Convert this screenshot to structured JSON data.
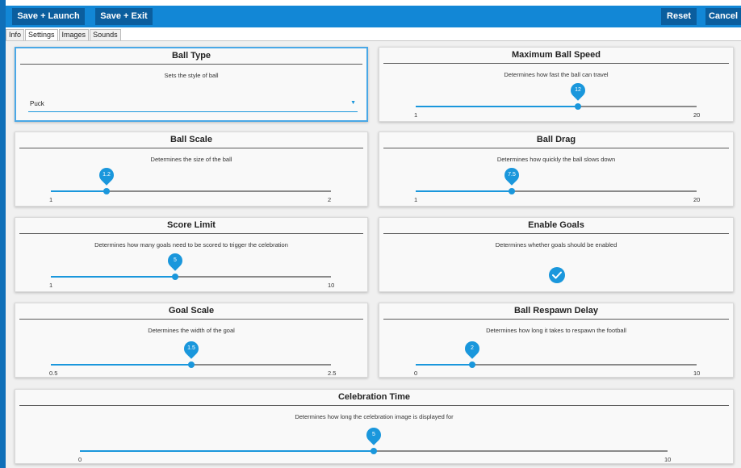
{
  "toolbar": {
    "save_launch": "Save + Launch",
    "save_exit": "Save + Exit",
    "reset": "Reset",
    "cancel": "Cancel"
  },
  "tabs": [
    {
      "label": "Info",
      "active": false
    },
    {
      "label": "Settings",
      "active": true
    },
    {
      "label": "Images",
      "active": false
    },
    {
      "label": "Sounds",
      "active": false
    }
  ],
  "settings": {
    "ball_type": {
      "title": "Ball Type",
      "desc": "Sets the style of ball",
      "value": "Puck"
    },
    "max_ball_speed": {
      "title": "Maximum Ball Speed",
      "desc": "Determines how fast the ball can travel",
      "value": "12",
      "value_num": 12,
      "min": "1",
      "max": "20",
      "min_num": 1,
      "max_num": 20
    },
    "ball_scale": {
      "title": "Ball Scale",
      "desc": "Determines the size of the ball",
      "value": "1.2",
      "value_num": 1.2,
      "min": "1",
      "max": "2",
      "min_num": 1,
      "max_num": 2
    },
    "ball_drag": {
      "title": "Ball Drag",
      "desc": "Determines how quickly the ball slows down",
      "value": "7.5",
      "value_num": 7.5,
      "min": "1",
      "max": "20",
      "min_num": 1,
      "max_num": 20
    },
    "score_limit": {
      "title": "Score Limit",
      "desc": "Determines how many goals need to be scored to trigger the celebration",
      "value": "5",
      "value_num": 5,
      "min": "1",
      "max": "10",
      "min_num": 1,
      "max_num": 10
    },
    "enable_goals": {
      "title": "Enable Goals",
      "desc": "Determines whether goals should be enabled",
      "checked": true
    },
    "goal_scale": {
      "title": "Goal Scale",
      "desc": "Determines the width of the goal",
      "value": "1.5",
      "value_num": 1.5,
      "min": "0.5",
      "max": "2.5",
      "min_num": 0.5,
      "max_num": 2.5
    },
    "ball_respawn_delay": {
      "title": "Ball Respawn Delay",
      "desc": "Determines how long it takes to respawn the football",
      "value": "2",
      "value_num": 2,
      "min": "0",
      "max": "10",
      "min_num": 0,
      "max_num": 10
    },
    "celebration_time": {
      "title": "Celebration Time",
      "desc": "Determines how long the celebration image is displayed for",
      "value": "5",
      "value_num": 5,
      "min": "0",
      "max": "10",
      "min_num": 0,
      "max_num": 10
    }
  },
  "colors": {
    "accent": "#1a97dc",
    "toolbar": "#1287d6",
    "toolbar_button": "#0b5e9e"
  }
}
